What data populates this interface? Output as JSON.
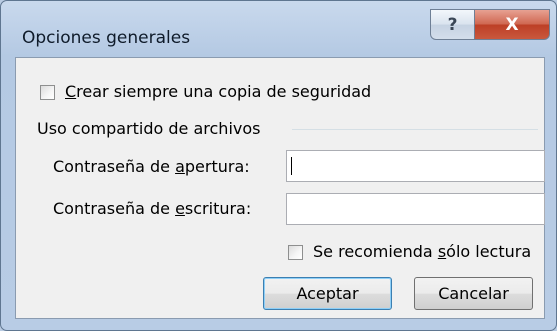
{
  "dialog": {
    "title": "Opciones generales",
    "help_glyph": "?",
    "close_glyph": "X"
  },
  "backup": {
    "label_u": "C",
    "label_rest": "rear siempre una copia de seguridad",
    "checked": false
  },
  "sharing": {
    "group_label": "Uso compartido de archivos",
    "open_password": {
      "label_pre": "Contraseña de ",
      "label_u": "a",
      "label_post": "pertura:",
      "value": ""
    },
    "write_password": {
      "label_pre": "Contraseña de ",
      "label_u": "e",
      "label_post": "scritura:",
      "value": ""
    },
    "readonly": {
      "label_pre": "Se recomienda ",
      "label_u": "s",
      "label_post": "ólo lectura",
      "checked": false
    }
  },
  "buttons": {
    "ok": "Aceptar",
    "cancel": "Cancelar"
  }
}
